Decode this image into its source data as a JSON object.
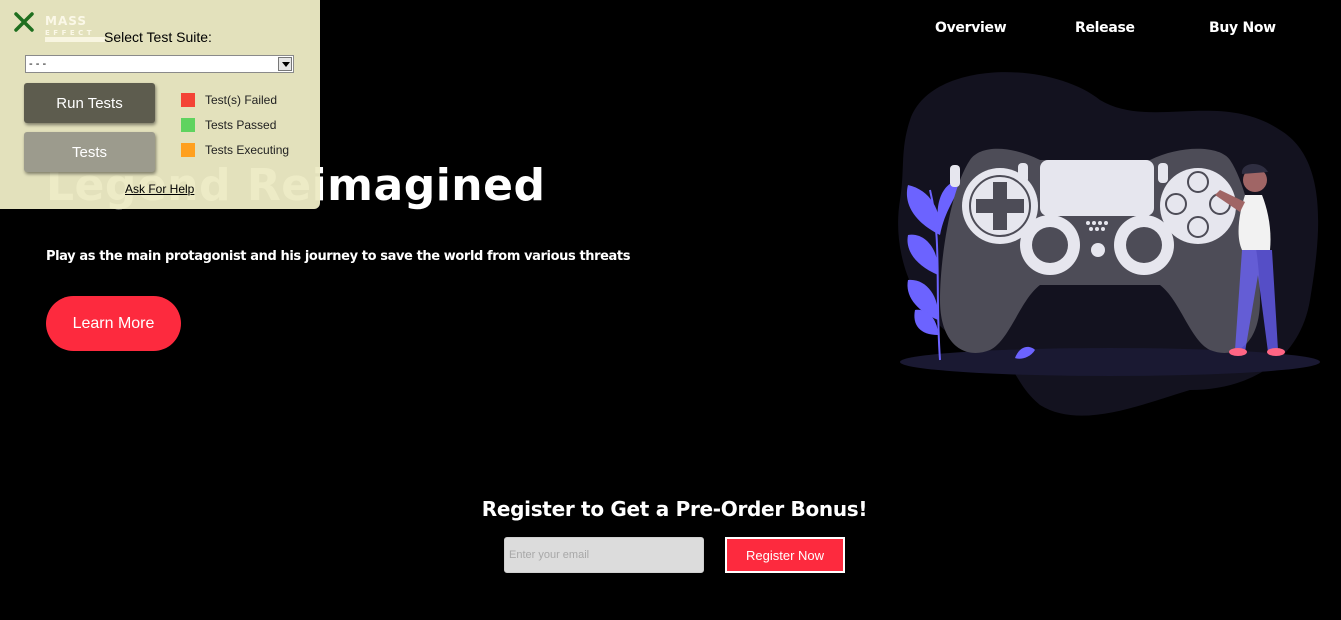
{
  "nav": {
    "items": [
      {
        "label": "Overview"
      },
      {
        "label": "Release"
      },
      {
        "label": "Buy Now"
      }
    ]
  },
  "hero": {
    "title": "Legend Reimagined",
    "subtitle": "Play as the main protagonist and his journey to save the world from various threats",
    "button_label": "Learn More",
    "button_color": "#fd2a3e"
  },
  "register": {
    "title": "Register to Get a Pre-Order Bonus!",
    "email_placeholder": "Enter your email",
    "button_label": "Register Now"
  },
  "test_panel": {
    "logo_text": "MASS EFFECT",
    "select_label": "Select Test Suite:",
    "selected_suite": "- - -",
    "run_button": "Run Tests",
    "tests_button": "Tests",
    "legend": [
      {
        "label": "Test(s) Failed",
        "color": "#f44336"
      },
      {
        "label": "Tests Passed",
        "color": "#5fd35f"
      },
      {
        "label": "Tests Executing",
        "color": "#ffa01e"
      }
    ],
    "help_link": "Ask For Help"
  },
  "illustration": {
    "icon": "gamepad-illustration",
    "accent_color": "#6c63ff"
  }
}
